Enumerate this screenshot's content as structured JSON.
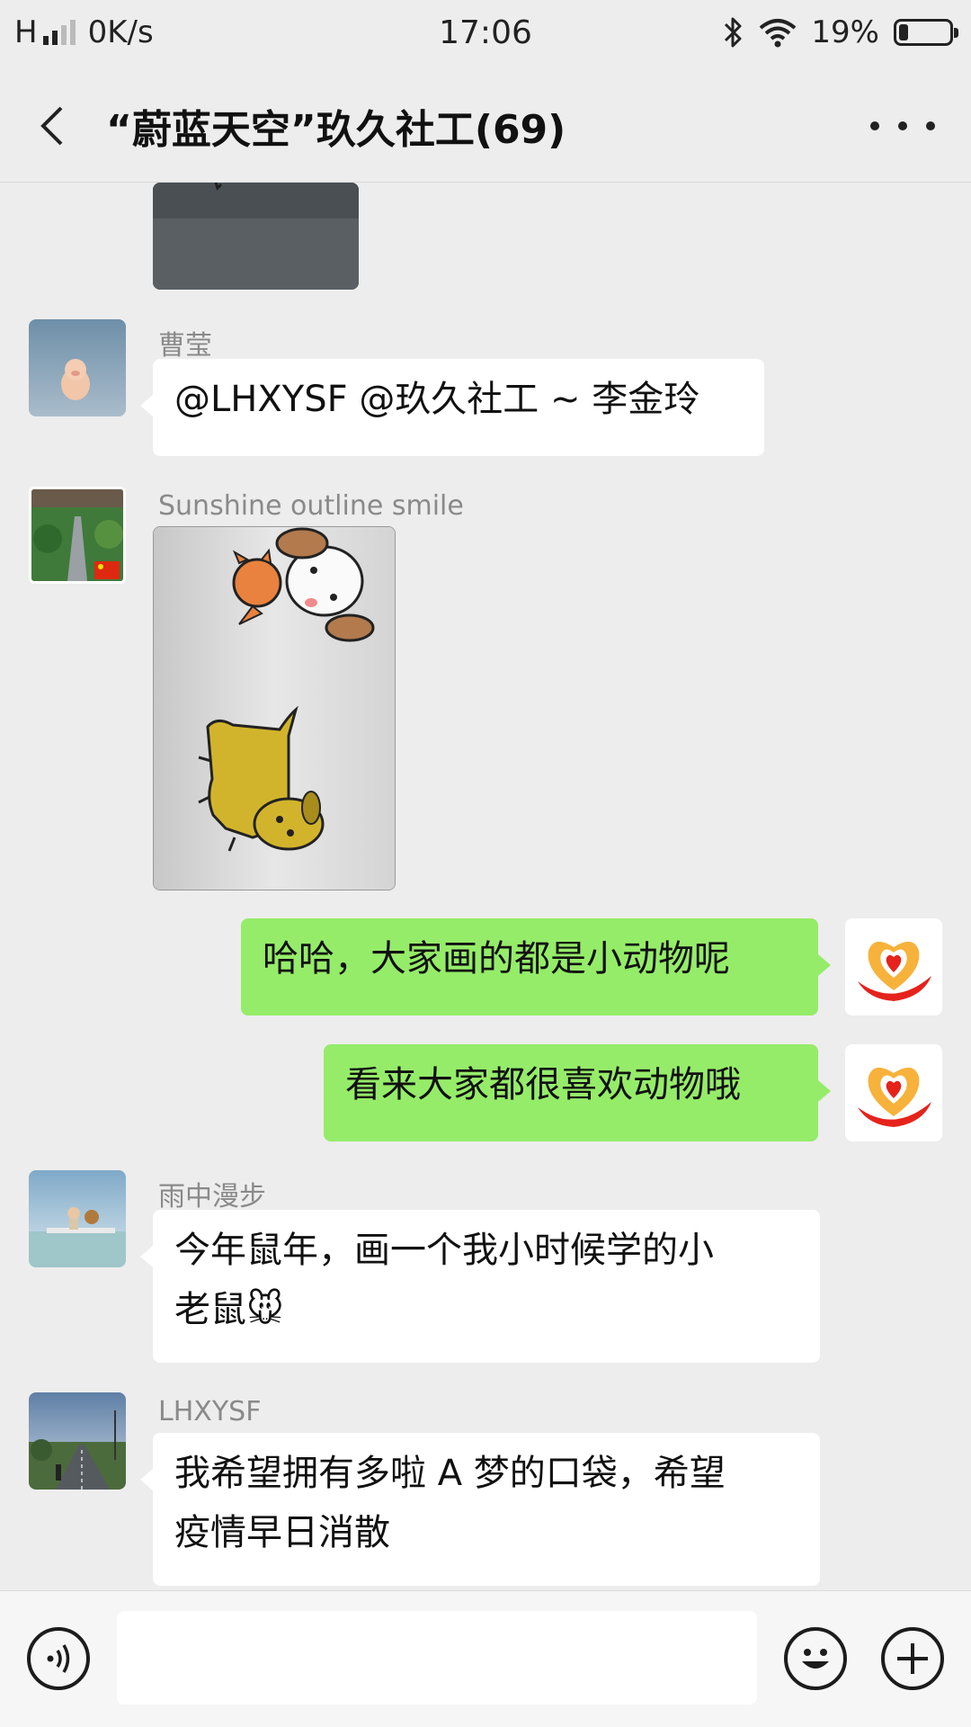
{
  "status_bar": {
    "network_type": "H",
    "speed": "0K/s",
    "time": "17:06",
    "battery_text": "19%",
    "battery_level": 0.19
  },
  "header": {
    "title": "“蔚蓝天空”玖久社工(69)",
    "back_icon": "chevron-left-icon",
    "more_icon": "more-dots-icon"
  },
  "messages": [
    {
      "type": "image",
      "side": "left",
      "content": "partial-image"
    },
    {
      "type": "text",
      "side": "left",
      "sender": "曹莹",
      "avatar": "pig-figurine-avatar",
      "text": "@LHXYSF @玖久社工 ~ 李金玲"
    },
    {
      "type": "image",
      "side": "left",
      "sender": "Sunshine outline smile",
      "avatar": "garden-path-avatar",
      "content": "drawing-of-puppies"
    },
    {
      "type": "text",
      "side": "right",
      "avatar": "heart-logo-avatar",
      "text": "哈哈，大家画的都是小动物呢"
    },
    {
      "type": "text",
      "side": "right",
      "avatar": "heart-logo-avatar",
      "text": "看来大家都很喜欢动物哦"
    },
    {
      "type": "text",
      "side": "left",
      "sender": "雨中漫步",
      "avatar": "sea-child-avatar",
      "lines": [
        "今年鼠年，画一个我小时候学的小",
        "老鼠🐭"
      ]
    },
    {
      "type": "text",
      "side": "left",
      "sender": "LHXYSF",
      "avatar": "road-landscape-avatar",
      "lines": [
        "我希望拥有多啦 A 梦的口袋，希望",
        "疫情早日消散"
      ]
    }
  ],
  "input_bar": {
    "voice_icon": "voice-icon",
    "emoji_icon": "emoji-icon",
    "plus_icon": "plus-icon",
    "placeholder": ""
  },
  "colors": {
    "own_bubble": "#95ec69",
    "other_bubble": "#ffffff",
    "background": "#ededed"
  }
}
